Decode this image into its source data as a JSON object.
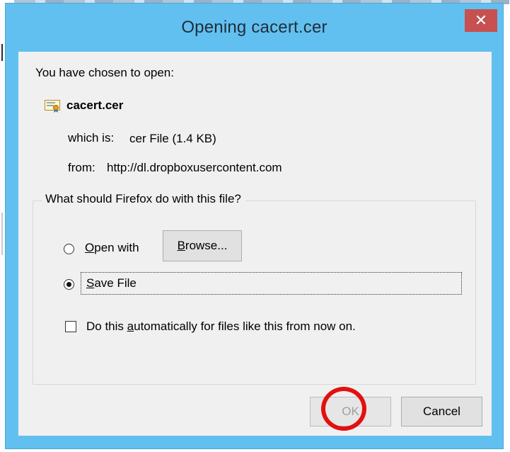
{
  "window": {
    "title": "Opening cacert.cer",
    "close_symbol": "✕"
  },
  "intro": "You have chosen to open:",
  "file": {
    "name": "cacert.cer",
    "icon": "certificate-file-icon",
    "which_is_label": "which is:",
    "which_is_value": "cer File (1.4 KB)",
    "from_label": "from:",
    "from_value": "http://dl.dropboxusercontent.com"
  },
  "action_group": {
    "legend": "What should Firefox do with this file?",
    "open_with": {
      "prefix": "",
      "mnemonic": "O",
      "rest": "pen with",
      "selected": false
    },
    "browse_button": {
      "mnemonic": "B",
      "rest": "rowse..."
    },
    "save_file": {
      "mnemonic": "S",
      "rest": "ave File",
      "selected": true
    },
    "auto": {
      "prefix": "Do this ",
      "mnemonic": "a",
      "rest": "utomatically for files like this from now on.",
      "checked": false
    }
  },
  "buttons": {
    "ok": "OK",
    "cancel": "Cancel"
  },
  "colors": {
    "title_bar": "#61c0ef",
    "close_button": "#c75050",
    "dialog_body": "#f0f0f0",
    "annotation": "#e31010"
  }
}
